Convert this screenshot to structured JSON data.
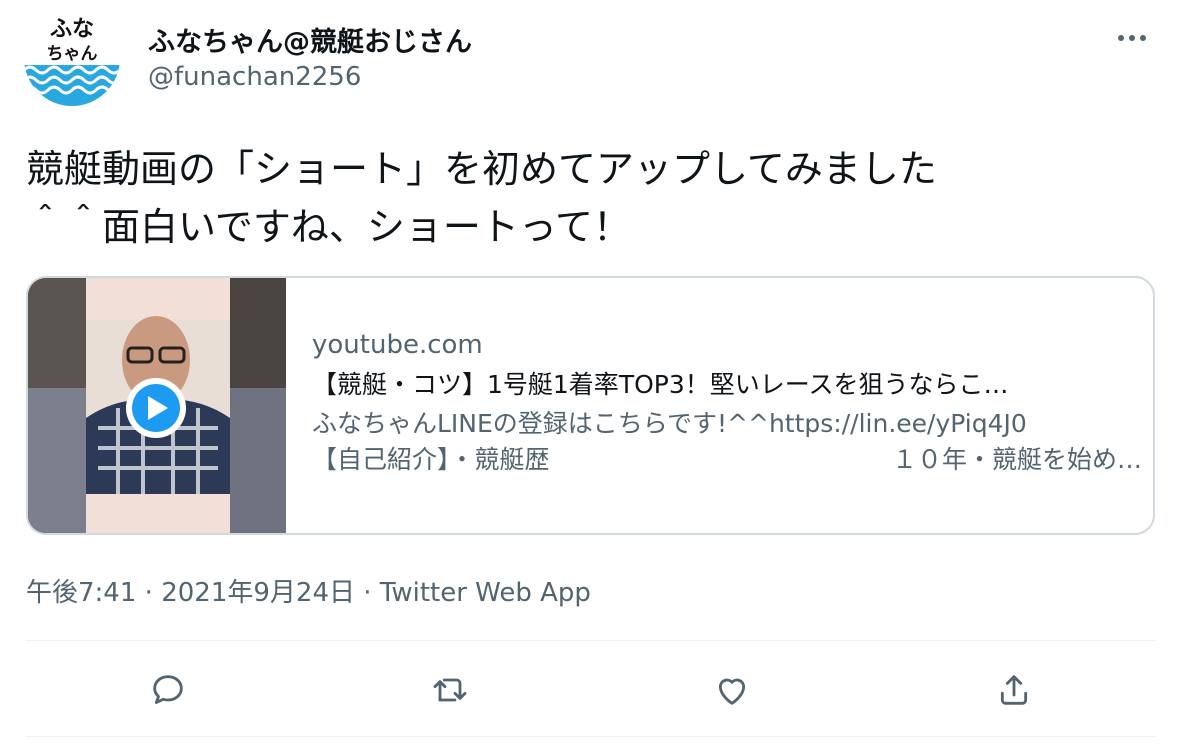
{
  "user": {
    "avatar_text_line1": "ふな",
    "avatar_text_line2": "ちゃん",
    "display_name": "ふなちゃん@競艇おじさん",
    "handle": "@funachan2256"
  },
  "tweet": {
    "text_line1": "競艇動画の「ショート」を初めてアップしてみました",
    "text_line2": "＾＾面白いですね、ショートって！"
  },
  "card": {
    "domain": "youtube.com",
    "title": "【競艇・コツ】1号艇1着率TOP3！堅いレースを狙うならこ…",
    "desc_line1": "ふなちゃんLINEの登録はこちらです!^^https://lin.ee/yPiq4J0",
    "desc_line2_left": "【自己紹介】・競艇歴",
    "desc_line2_right": "１０年・競艇を始め…",
    "play_icon": "play-icon"
  },
  "meta": {
    "time": "午後7:41",
    "sep1": " · ",
    "date": "2021年9月24日",
    "sep2": " · ",
    "source": "Twitter Web App"
  },
  "icons": [
    "more-icon",
    "reply-icon",
    "retweet-icon",
    "like-icon",
    "share-icon"
  ],
  "colors": {
    "text": "#0f1419",
    "secondary": "#536471",
    "accent": "#1d9bf0",
    "border": "#cfd9de"
  }
}
